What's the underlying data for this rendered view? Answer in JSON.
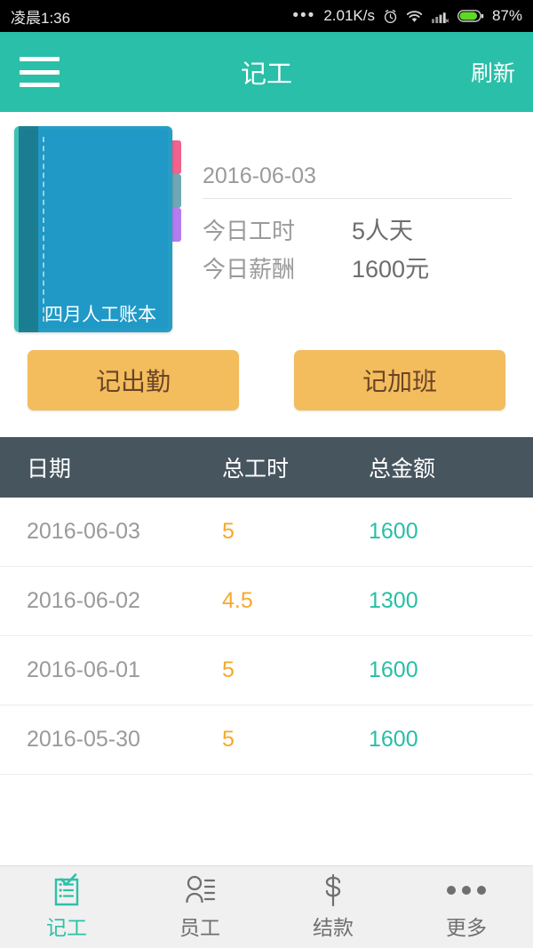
{
  "status_bar": {
    "time": "凌晨1:36",
    "overflow_dots": "•••",
    "net_speed": "2.01K/s",
    "alarm_icon": "alarm-icon",
    "wifi_icon": "wifi-icon",
    "signal_icon": "signal-icon",
    "battery_icon": "battery-icon",
    "battery_percent": "87%"
  },
  "app_bar": {
    "menu_icon": "hamburger-menu-icon",
    "title": "记工",
    "action_label": "刷新"
  },
  "summary": {
    "book": {
      "label": "四月人工账本",
      "tab_colors": [
        "#f2628d",
        "#6fa8b4",
        "#b57cf0"
      ]
    },
    "date": "2016-06-03",
    "rows": [
      {
        "label": "今日工时",
        "value": "5人天"
      },
      {
        "label": "今日薪酬",
        "value": "1600元"
      }
    ]
  },
  "actions": {
    "attendance_label": "记出勤",
    "overtime_label": "记加班"
  },
  "table": {
    "columns": [
      "日期",
      "总工时",
      "总金额"
    ],
    "rows": [
      {
        "date": "2016-06-03",
        "hours": "5",
        "amount": "1600"
      },
      {
        "date": "2016-06-02",
        "hours": "4.5",
        "amount": "1300"
      },
      {
        "date": "2016-06-01",
        "hours": "5",
        "amount": "1600"
      },
      {
        "date": "2016-05-30",
        "hours": "5",
        "amount": "1600"
      }
    ]
  },
  "bottom_nav": {
    "items": [
      {
        "label": "记工",
        "icon": "clipboard-check-icon",
        "active": true
      },
      {
        "label": "员工",
        "icon": "person-list-icon",
        "active": false
      },
      {
        "label": "结款",
        "icon": "dollar-sign-icon",
        "active": false
      },
      {
        "label": "更多",
        "icon": "more-dots-icon",
        "active": false
      }
    ]
  },
  "colors": {
    "accent_teal": "#29bfa8",
    "amount_teal": "#26bfa5",
    "hours_orange": "#f7a928",
    "button_orange": "#f3bd5e",
    "table_header": "#47555f"
  }
}
